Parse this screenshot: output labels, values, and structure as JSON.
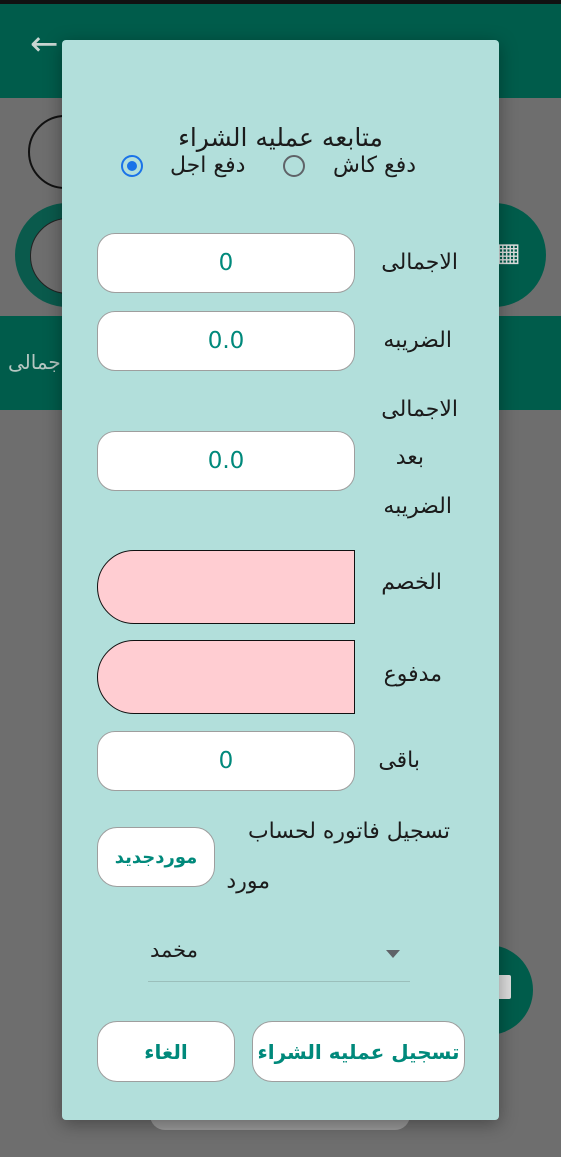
{
  "dialog": {
    "title": "متابعه عمليه الشراء",
    "payment": {
      "cash_label": "دفع كاش",
      "deferred_label": "دفع اجل",
      "selected": "deferred"
    },
    "fields": {
      "total": {
        "label": "الاجمالى",
        "value": "0"
      },
      "tax": {
        "label": "الضريبه",
        "value": "0.0"
      },
      "total_after_tax": {
        "label_line1": "الاجمالى",
        "label_line2": "بعد",
        "label_line3": "الضريبه",
        "value": "0.0"
      },
      "discount": {
        "label": "الخصم",
        "value": ""
      },
      "paid": {
        "label": "مدفوع",
        "value": ""
      },
      "remaining": {
        "label": "باقى",
        "value": "0"
      }
    },
    "supplier": {
      "label_line1": "تسجيل فاتوره لحساب",
      "label_line2": "مورد",
      "new_supplier_button": "موردجديد",
      "selected_supplier": "مخمد"
    },
    "buttons": {
      "confirm": "تسجيل عمليه الشراء",
      "cancel": "الغاء"
    }
  },
  "background": {
    "header_label": "جمالى"
  }
}
